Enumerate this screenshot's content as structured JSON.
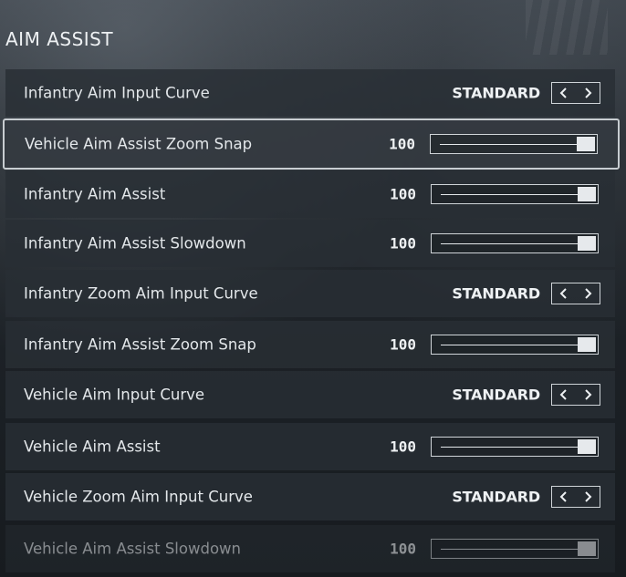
{
  "section": {
    "title": "AIM ASSIST"
  },
  "settings": [
    {
      "label": "Infantry Aim Input Curve",
      "type": "choice",
      "value": "STANDARD"
    },
    {
      "label": "Vehicle Aim Assist Zoom Snap",
      "type": "slider",
      "value": "100",
      "level": 1.0,
      "selected": true
    },
    {
      "label": "Infantry Aim Assist",
      "type": "slider",
      "value": "100",
      "level": 1.0
    },
    {
      "label": "Infantry Aim Assist Slowdown",
      "type": "slider",
      "value": "100",
      "level": 1.0
    },
    {
      "label": "Infantry Zoom Aim Input Curve",
      "type": "choice",
      "value": "STANDARD"
    },
    {
      "label": "Infantry Aim Assist Zoom Snap",
      "type": "slider",
      "value": "100",
      "level": 1.0
    },
    {
      "label": "Vehicle Aim Input Curve",
      "type": "choice",
      "value": "STANDARD"
    },
    {
      "label": "Vehicle Aim Assist",
      "type": "slider",
      "value": "100",
      "level": 1.0
    },
    {
      "label": "Vehicle Zoom Aim Input Curve",
      "type": "choice",
      "value": "STANDARD"
    },
    {
      "label": "Vehicle Aim Assist Slowdown",
      "type": "slider",
      "value": "100",
      "level": 1.0,
      "dimmed": true
    }
  ],
  "icons": {
    "prev": "chevron-left-icon",
    "next": "chevron-right-icon"
  },
  "colors": {
    "text": "#e3e7ea",
    "row_bg": "#282e34",
    "border": "#cfd4d8"
  }
}
